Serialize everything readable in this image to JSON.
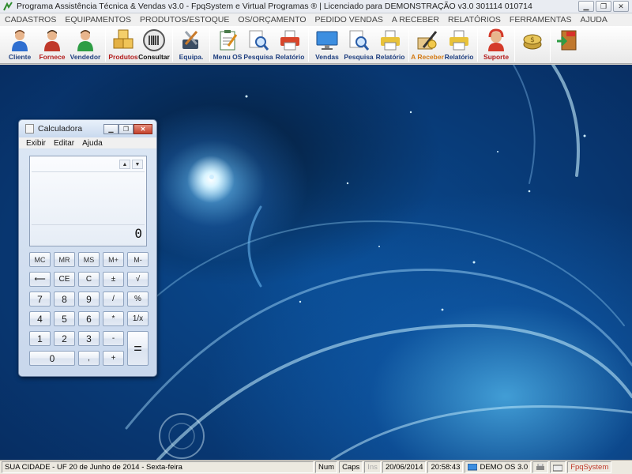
{
  "window": {
    "title": "Programa Assistência Técnica & Vendas v3.0 - FpqSystem e Virtual Programas ® | Licenciado para  DEMONSTRAÇÃO v3.0 301114 010714",
    "min_glyph": "▁",
    "max_glyph": "❐",
    "close_glyph": "✕"
  },
  "menubar": [
    "CADASTROS",
    "EQUIPAMENTOS",
    "PRODUTOS/ESTOQUE",
    "OS/ORÇAMENTO",
    "PEDIDO VENDAS",
    "A RECEBER",
    "RELATÓRIOS",
    "FERRAMENTAS",
    "AJUDA"
  ],
  "toolbar": {
    "cliente": "Cliente",
    "fornece": "Fornece",
    "vendedor": "Vendedor",
    "produtos": "Produtos",
    "consultar": "Consultar",
    "equipa": "Equipa.",
    "menu_os": "Menu OS",
    "pesquisa_os": "Pesquisa",
    "relatorio_os": "Relatório",
    "vendas": "Vendas",
    "pesquisa_vendas": "Pesquisa",
    "relatorio_vendas": "Relatório",
    "a_receber": "A Receber",
    "relatorio_receber": "Relatório",
    "suporte": "Suporte"
  },
  "calculator": {
    "title": "Calculadora",
    "menu": [
      "Exibir",
      "Editar",
      "Ajuda"
    ],
    "display": "0",
    "keys": {
      "mc": "MC",
      "mr": "MR",
      "ms": "MS",
      "mplus": "M+",
      "mminus": "M-",
      "back": "⟵",
      "ce": "CE",
      "c": "C",
      "pm": "±",
      "sqrt": "√",
      "k7": "7",
      "k8": "8",
      "k9": "9",
      "div": "/",
      "pct": "%",
      "k4": "4",
      "k5": "5",
      "k6": "6",
      "mul": "*",
      "inv": "1/x",
      "k1": "1",
      "k2": "2",
      "k3": "3",
      "sub": "-",
      "eq": "=",
      "k0": "0",
      "dot": ",",
      "add": "+"
    }
  },
  "statusbar": {
    "location": "SUA CIDADE - UF 20 de Junho de 2014 - Sexta-feira",
    "num": "Num",
    "caps": "Caps",
    "ins": "Ins",
    "date": "20/06/2014",
    "time": "20:58:43",
    "version": "DEMO OS 3.0",
    "brand": "FpqSystem"
  },
  "colors": {
    "brand_red": "#c0392b",
    "toolbar_label": "#1f3f7f",
    "desktop_blue": "#0a4c93"
  }
}
